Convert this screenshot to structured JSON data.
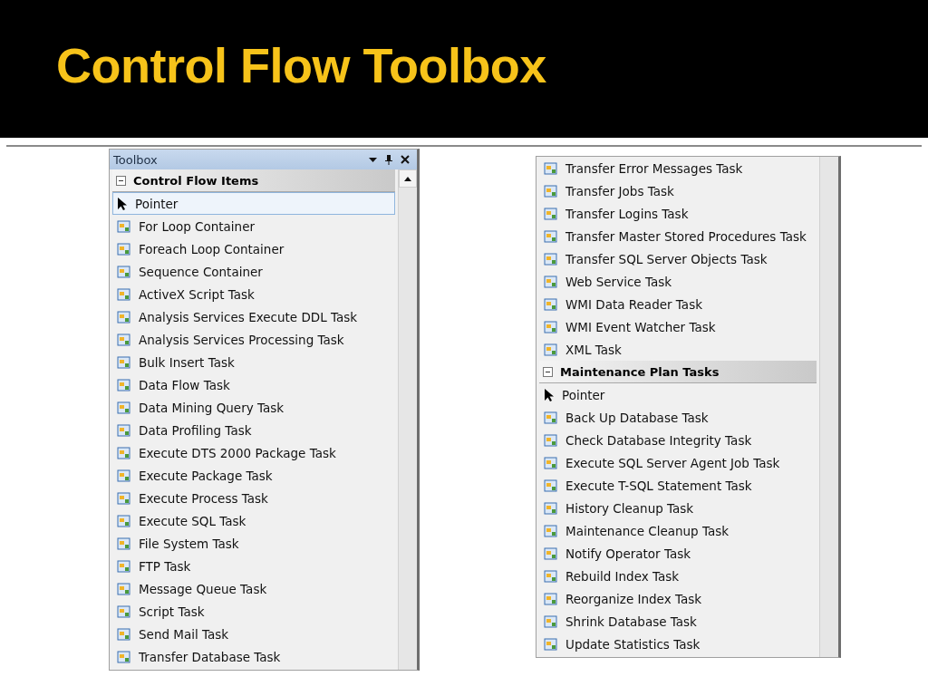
{
  "slide": {
    "title": "Control Flow Toolbox"
  },
  "panels": [
    {
      "title": "Toolbox",
      "groups": [
        {
          "header": "Control Flow Items",
          "expanded": true,
          "items": [
            {
              "label": "Pointer",
              "kind": "pointer",
              "selected": true
            },
            {
              "label": "For Loop Container",
              "kind": "task",
              "selected": false
            },
            {
              "label": "Foreach Loop Container",
              "kind": "task",
              "selected": false
            },
            {
              "label": "Sequence Container",
              "kind": "task",
              "selected": false
            },
            {
              "label": "ActiveX Script Task",
              "kind": "task",
              "selected": false
            },
            {
              "label": "Analysis Services Execute DDL Task",
              "kind": "task",
              "selected": false
            },
            {
              "label": "Analysis Services Processing Task",
              "kind": "task",
              "selected": false
            },
            {
              "label": "Bulk Insert Task",
              "kind": "task",
              "selected": false
            },
            {
              "label": "Data Flow Task",
              "kind": "task",
              "selected": false
            },
            {
              "label": "Data Mining Query Task",
              "kind": "task",
              "selected": false
            },
            {
              "label": "Data Profiling Task",
              "kind": "task",
              "selected": false
            },
            {
              "label": "Execute DTS 2000 Package Task",
              "kind": "task",
              "selected": false
            },
            {
              "label": "Execute Package Task",
              "kind": "task",
              "selected": false
            },
            {
              "label": "Execute Process Task",
              "kind": "task",
              "selected": false
            },
            {
              "label": "Execute SQL Task",
              "kind": "task",
              "selected": false
            },
            {
              "label": "File System Task",
              "kind": "task",
              "selected": false
            },
            {
              "label": "FTP Task",
              "kind": "task",
              "selected": false
            },
            {
              "label": "Message Queue Task",
              "kind": "task",
              "selected": false
            },
            {
              "label": "Script Task",
              "kind": "task",
              "selected": false
            },
            {
              "label": "Send Mail Task",
              "kind": "task",
              "selected": false
            },
            {
              "label": "Transfer Database Task",
              "kind": "task",
              "selected": false
            }
          ]
        }
      ]
    },
    {
      "groups": [
        {
          "items": [
            {
              "label": "Transfer Error Messages Task",
              "kind": "task",
              "selected": false
            },
            {
              "label": "Transfer Jobs Task",
              "kind": "task",
              "selected": false
            },
            {
              "label": "Transfer Logins Task",
              "kind": "task",
              "selected": false
            },
            {
              "label": "Transfer Master Stored Procedures Task",
              "kind": "task",
              "selected": false
            },
            {
              "label": "Transfer SQL Server Objects Task",
              "kind": "task",
              "selected": false
            },
            {
              "label": "Web Service Task",
              "kind": "task",
              "selected": false
            },
            {
              "label": "WMI Data Reader Task",
              "kind": "task",
              "selected": false
            },
            {
              "label": "WMI Event Watcher Task",
              "kind": "task",
              "selected": false
            },
            {
              "label": "XML Task",
              "kind": "task",
              "selected": false
            }
          ]
        },
        {
          "header": "Maintenance Plan Tasks",
          "expanded": true,
          "items": [
            {
              "label": "Pointer",
              "kind": "pointer",
              "selected": false
            },
            {
              "label": "Back Up Database Task",
              "kind": "task",
              "selected": false
            },
            {
              "label": "Check Database Integrity Task",
              "kind": "task",
              "selected": false
            },
            {
              "label": "Execute SQL Server Agent Job Task",
              "kind": "task",
              "selected": false
            },
            {
              "label": "Execute T-SQL Statement Task",
              "kind": "task",
              "selected": false
            },
            {
              "label": "History Cleanup Task",
              "kind": "task",
              "selected": false
            },
            {
              "label": "Maintenance Cleanup Task",
              "kind": "task",
              "selected": false
            },
            {
              "label": "Notify Operator Task",
              "kind": "task",
              "selected": false
            },
            {
              "label": "Rebuild Index Task",
              "kind": "task",
              "selected": false
            },
            {
              "label": "Reorganize Index Task",
              "kind": "task",
              "selected": false
            },
            {
              "label": "Shrink Database Task",
              "kind": "task",
              "selected": false
            },
            {
              "label": "Update Statistics Task",
              "kind": "task",
              "selected": false
            }
          ]
        }
      ]
    }
  ]
}
